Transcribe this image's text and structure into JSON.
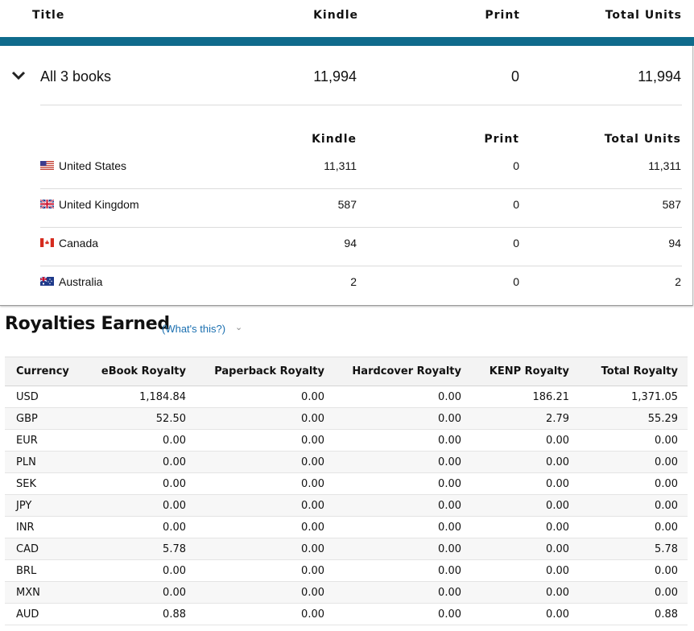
{
  "units": {
    "headers": {
      "title": "Title",
      "kindle": "Kindle",
      "print": "Print",
      "total": "Total Units"
    },
    "summary": {
      "title": "All 3 books",
      "kindle": "11,994",
      "print": "0",
      "total": "11,994"
    },
    "sub_headers": {
      "kindle": "Kindle",
      "print": "Print",
      "total": "Total Units"
    },
    "marketplaces": [
      {
        "name": "United States",
        "flag": "us-flag-icon",
        "kindle": "11,311",
        "print": "0",
        "total": "11,311"
      },
      {
        "name": "United Kingdom",
        "flag": "uk-flag-icon",
        "kindle": "587",
        "print": "0",
        "total": "587"
      },
      {
        "name": "Canada",
        "flag": "canada-flag-icon",
        "kindle": "94",
        "print": "0",
        "total": "94"
      },
      {
        "name": "Australia",
        "flag": "australia-flag-icon",
        "kindle": "2",
        "print": "0",
        "total": "2"
      }
    ]
  },
  "royalties": {
    "title": "Royalties Earned",
    "help_link": "(What's this?)",
    "columns": [
      "Currency",
      "eBook Royalty",
      "Paperback Royalty",
      "Hardcover Royalty",
      "KENP Royalty",
      "Total Royalty"
    ],
    "rows": [
      [
        "USD",
        "1,184.84",
        "0.00",
        "0.00",
        "186.21",
        "1,371.05"
      ],
      [
        "GBP",
        "52.50",
        "0.00",
        "0.00",
        "2.79",
        "55.29"
      ],
      [
        "EUR",
        "0.00",
        "0.00",
        "0.00",
        "0.00",
        "0.00"
      ],
      [
        "PLN",
        "0.00",
        "0.00",
        "0.00",
        "0.00",
        "0.00"
      ],
      [
        "SEK",
        "0.00",
        "0.00",
        "0.00",
        "0.00",
        "0.00"
      ],
      [
        "JPY",
        "0.00",
        "0.00",
        "0.00",
        "0.00",
        "0.00"
      ],
      [
        "INR",
        "0.00",
        "0.00",
        "0.00",
        "0.00",
        "0.00"
      ],
      [
        "CAD",
        "5.78",
        "0.00",
        "0.00",
        "0.00",
        "5.78"
      ],
      [
        "BRL",
        "0.00",
        "0.00",
        "0.00",
        "0.00",
        "0.00"
      ],
      [
        "MXN",
        "0.00",
        "0.00",
        "0.00",
        "0.00",
        "0.00"
      ],
      [
        "AUD",
        "0.88",
        "0.00",
        "0.00",
        "0.00",
        "0.88"
      ]
    ]
  },
  "colors": {
    "accent_bar": "#0f6b8c",
    "link": "#1a6fb0"
  }
}
